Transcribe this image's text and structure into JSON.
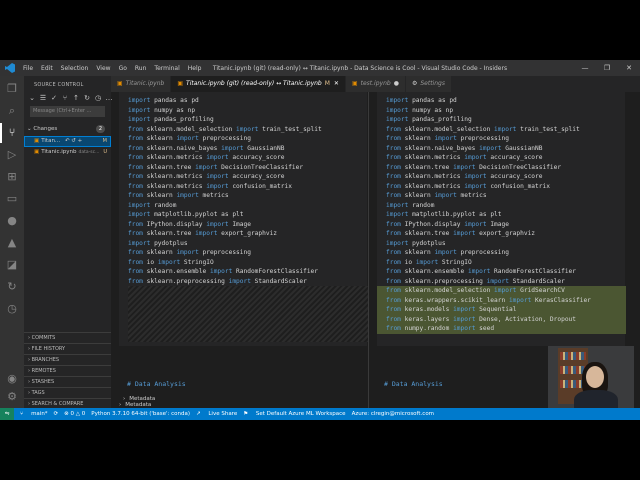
{
  "window": {
    "title": "Titanic.ipynb (git) (read-only) ↔ Titanic.ipynb - Data Science is Cool - Visual Studio Code - Insiders",
    "menu": [
      "File",
      "Edit",
      "Selection",
      "View",
      "Go",
      "Run",
      "Terminal",
      "Help"
    ],
    "controls": [
      "—",
      "❐",
      "✕"
    ]
  },
  "sidebar": {
    "title": "SOURCE CONTROL",
    "message_placeholder": "Message (Ctrl+Enter ...",
    "changes_label": "Changes",
    "changes_count": "2",
    "files": [
      {
        "name": "Titan...",
        "path": "",
        "status": "M"
      },
      {
        "name": "Titanic.ipynb",
        "path": "data-sc...",
        "status": "U"
      }
    ],
    "panels": [
      "COMMITS",
      "FILE HISTORY",
      "BRANCHES",
      "REMOTES",
      "STASHES",
      "TAGS",
      "SEARCH & COMPARE"
    ]
  },
  "tabs": [
    {
      "label": "Titanic.ipynb",
      "modified": "",
      "active": false
    },
    {
      "label": "Titanic.ipynb (git) (read-only) ↔ Titanic.ipynb",
      "modified": "M",
      "active": true
    },
    {
      "label": "test.ipynb",
      "modified": "●",
      "active": false
    },
    {
      "label": "Settings",
      "modified": "",
      "active": false
    }
  ],
  "diff": {
    "left_lines": [
      {
        "kw": "import",
        "rest": " pandas as pd"
      },
      {
        "kw": "import",
        "rest": " numpy as np"
      },
      {
        "kw": "import",
        "rest": " pandas_profiling"
      },
      {
        "kw": "from",
        "rest": " sklearn.model_selection import train_test_split"
      },
      {
        "kw": "from",
        "rest": " sklearn import preprocessing"
      },
      {
        "kw": "from",
        "rest": " sklearn.naive_bayes import GaussianNB"
      },
      {
        "kw": "from",
        "rest": " sklearn.metrics import accuracy_score"
      },
      {
        "kw": "from",
        "rest": " sklearn.tree import DecisionTreeClassifier"
      },
      {
        "kw": "from",
        "rest": " sklearn.metrics import accuracy_score"
      },
      {
        "kw": "from",
        "rest": " sklearn.metrics import confusion_matrix"
      },
      {
        "kw": "from",
        "rest": " sklearn import metrics"
      },
      {
        "kw": "import",
        "rest": " random"
      },
      {
        "kw": "import",
        "rest": " matplotlib.pyplot as plt"
      },
      {
        "kw": "from",
        "rest": " IPython.display import Image"
      },
      {
        "kw": "from",
        "rest": " sklearn.tree import export_graphviz"
      },
      {
        "kw": "import",
        "rest": " pydotplus"
      },
      {
        "kw": "from",
        "rest": " sklearn import preprocessing"
      },
      {
        "kw": "from",
        "rest": " io import StringIO"
      },
      {
        "kw": "from",
        "rest": " sklearn.ensemble import RandomForestClassifier"
      },
      {
        "kw": "from",
        "rest": " sklearn.preprocessing import StandardScaler"
      }
    ],
    "right_lines": [
      {
        "kw": "import",
        "rest": " pandas as pd"
      },
      {
        "kw": "import",
        "rest": " numpy as np"
      },
      {
        "kw": "import",
        "rest": " pandas_profiling"
      },
      {
        "kw": "from",
        "rest": " sklearn.model_selection import train_test_split"
      },
      {
        "kw": "from",
        "rest": " sklearn import preprocessing"
      },
      {
        "kw": "from",
        "rest": " sklearn.naive_bayes import GaussianNB"
      },
      {
        "kw": "from",
        "rest": " sklearn.metrics import accuracy_score"
      },
      {
        "kw": "from",
        "rest": " sklearn.tree import DecisionTreeClassifier"
      },
      {
        "kw": "from",
        "rest": " sklearn.metrics import accuracy_score"
      },
      {
        "kw": "from",
        "rest": " sklearn.metrics import confusion_matrix"
      },
      {
        "kw": "from",
        "rest": " sklearn import metrics"
      },
      {
        "kw": "import",
        "rest": " random"
      },
      {
        "kw": "import",
        "rest": " matplotlib.pyplot as plt"
      },
      {
        "kw": "from",
        "rest": " IPython.display import Image"
      },
      {
        "kw": "from",
        "rest": " sklearn.tree import export_graphviz"
      },
      {
        "kw": "import",
        "rest": " pydotplus"
      },
      {
        "kw": "from",
        "rest": " sklearn import preprocessing"
      },
      {
        "kw": "from",
        "rest": " io import StringIO"
      },
      {
        "kw": "from",
        "rest": " sklearn.ensemble import RandomForestClassifier"
      },
      {
        "kw": "from",
        "rest": " sklearn.preprocessing import StandardScaler"
      },
      {
        "kw": "from",
        "rest": " sklearn.model_selection import GridSearchCV",
        "added": true
      },
      {
        "kw": "from",
        "rest": " keras.wrappers.scikit_learn import KerasClassifier",
        "added": true
      },
      {
        "kw": "from",
        "rest": " keras.models import Sequential",
        "added": true
      },
      {
        "kw": "from",
        "rest": " keras.layers import Dense, Activation, Dropout",
        "added": true
      },
      {
        "kw": "from",
        "rest": " numpy.random import seed",
        "added": true
      }
    ],
    "metadata_label": "Metadata",
    "markdown_heading": "# Data Analysis"
  },
  "statusbar": {
    "branch": "main*",
    "sync": "⟳",
    "errors": "⊗ 0 △ 0",
    "python": "Python 3.7.10 64-bit ('base': conda)",
    "liveshare": "Live Share",
    "azureml": "Set Default Azure ML Workspace",
    "azure": "Azure: clregin@microsoft.com"
  }
}
